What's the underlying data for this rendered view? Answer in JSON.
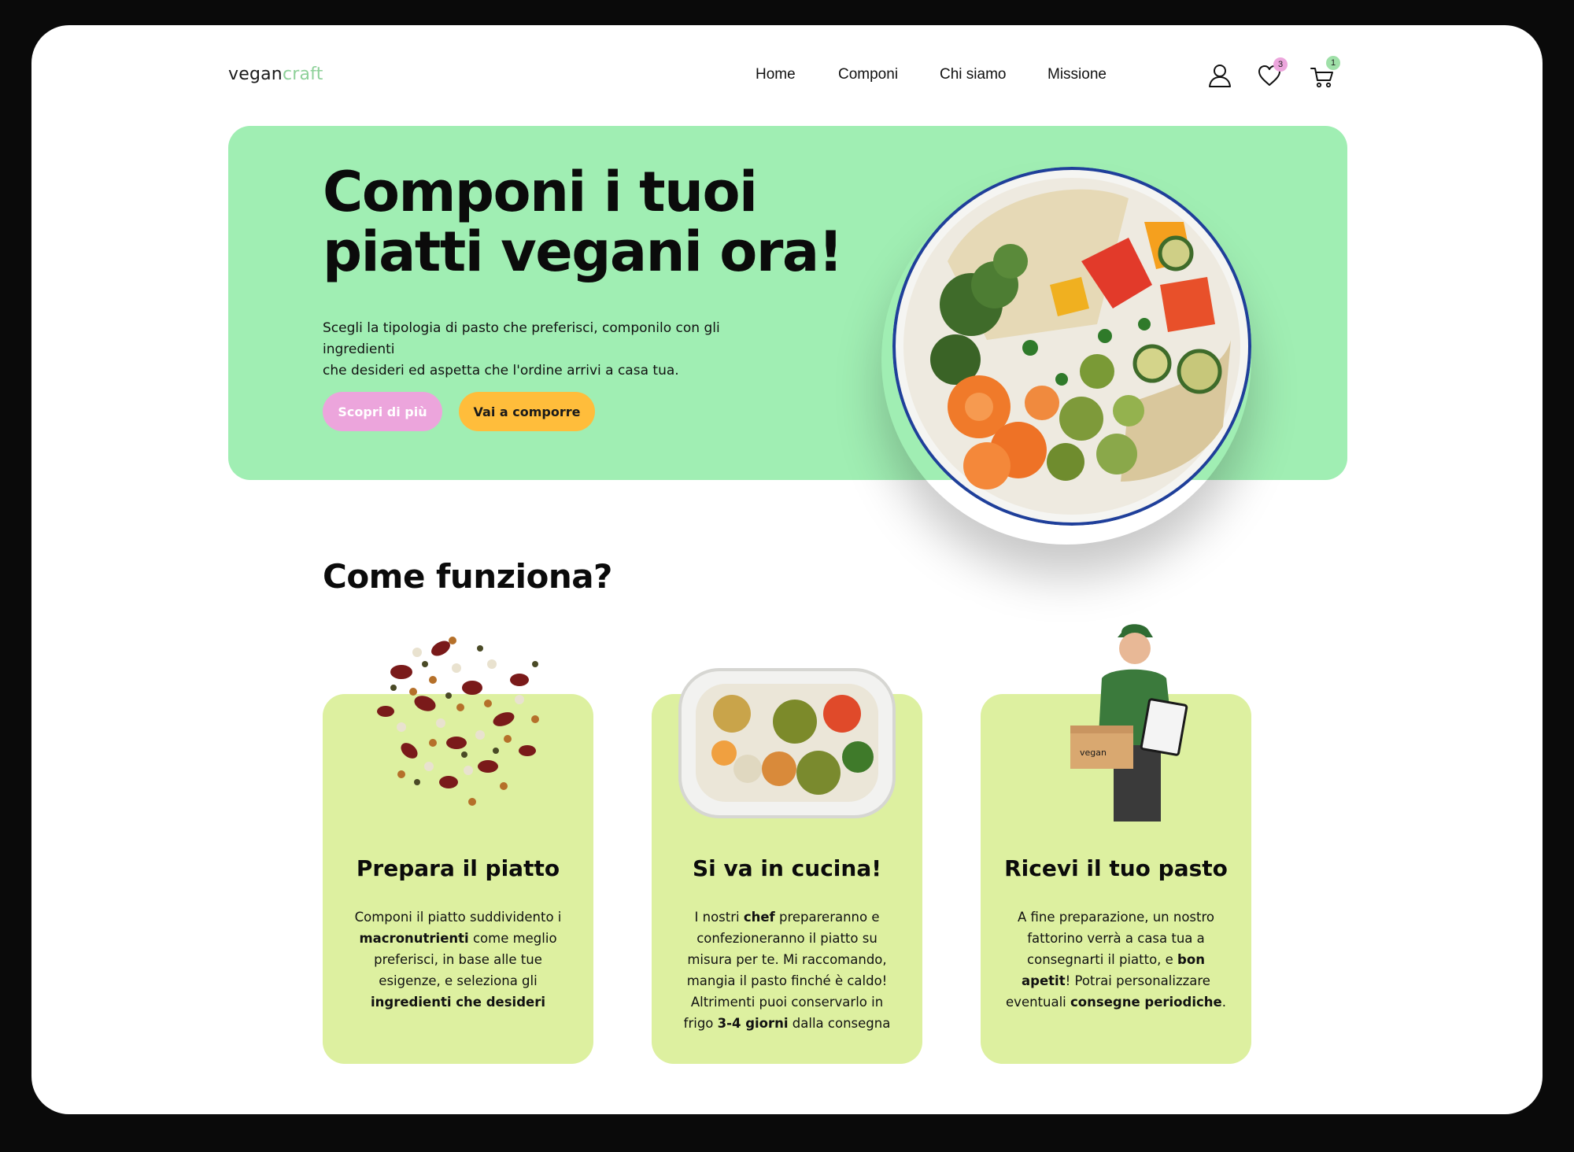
{
  "brand": {
    "part1": "vegan",
    "part2": "craft"
  },
  "nav": {
    "items": [
      "Home",
      "Componi",
      "Chi siamo",
      "Missione"
    ]
  },
  "header_icons": {
    "user": "user-icon",
    "wishlist": "heart-icon",
    "cart": "cart-icon"
  },
  "badges": {
    "wishlist": "3",
    "cart": "1"
  },
  "hero": {
    "title_line1": "Componi i tuoi",
    "title_line2": "piatti vegani ora!",
    "text_line1": "Scegli la tipologia di pasto che preferisci, componilo con gli ingredienti",
    "text_line2": "che desideri ed aspetta che l'ordine arrivi a casa tua.",
    "primary_button": "Scopri di più",
    "secondary_button": "Vai a comporre"
  },
  "section": {
    "title": "Come funziona?",
    "cards": [
      {
        "title": "Prepara il piatto",
        "text": [
          {
            "t": "Componi il piatto suddividento i "
          },
          {
            "t": "macronutrienti",
            "b": true
          },
          {
            "t": " come meglio preferisci, in base alle tue esigenze, e seleziona gli "
          },
          {
            "t": "ingredienti che desideri",
            "b": true
          }
        ]
      },
      {
        "title": "Si va in cucina!",
        "text": [
          {
            "t": "I nostri "
          },
          {
            "t": "chef",
            "b": true
          },
          {
            "t": " prepareranno e confezioneranno il piatto su misura per te. Mi raccomando, mangia il pasto finché è caldo! Altrimenti puoi conservarlo in frigo "
          },
          {
            "t": "3-4 giorni",
            "b": true
          },
          {
            "t": " dalla consegna"
          }
        ]
      },
      {
        "title": "Ricevi il tuo pasto",
        "text": [
          {
            "t": "A fine preparazione, un nostro fattorino verrà a casa tua a consegnarti il piatto, e "
          },
          {
            "t": "bon apetit",
            "b": true
          },
          {
            "t": "! Potrai personalizzare eventuali "
          },
          {
            "t": "consegne periodiche",
            "b": true
          },
          {
            "t": "."
          }
        ]
      }
    ]
  },
  "box_label": "vegan",
  "colors": {
    "hero_bg": "#a0eeb3",
    "card_bg": "#ddf0a0",
    "accent_pink": "#eca5dc",
    "accent_yellow": "#ffbd3b",
    "brand_green": "#8fd19a"
  }
}
